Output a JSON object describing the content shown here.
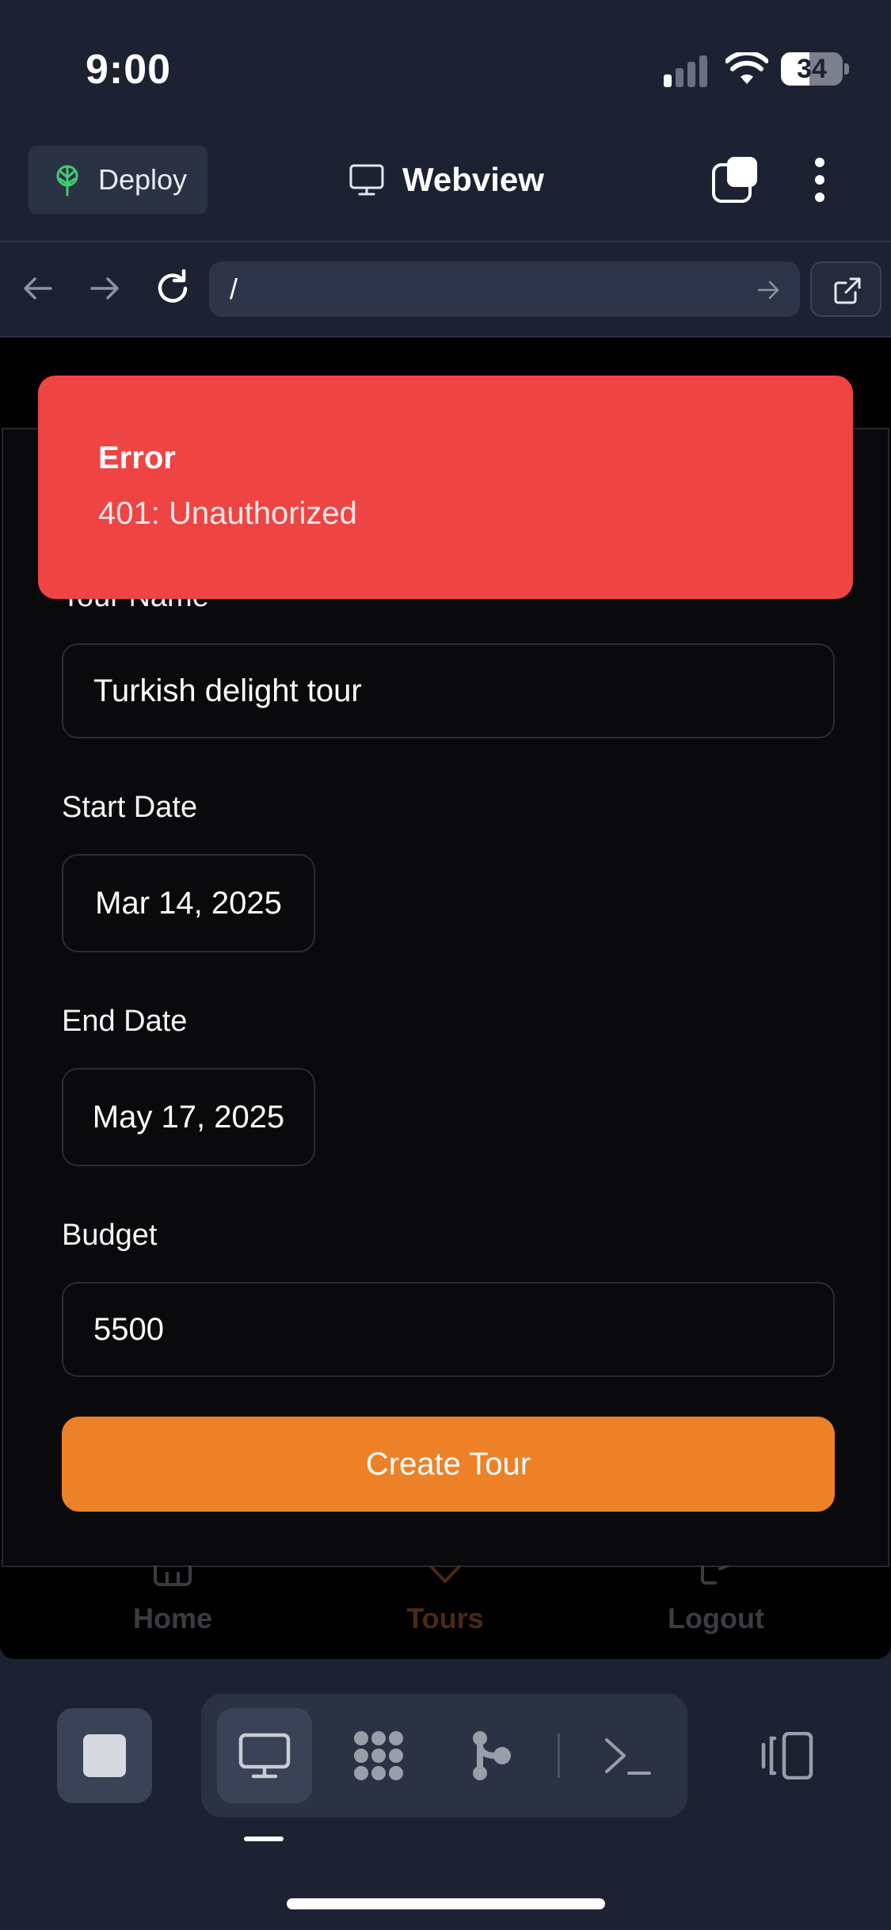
{
  "status_bar": {
    "time": "9:00",
    "battery": "34"
  },
  "header": {
    "deploy_label": "Deploy",
    "title": "Webview"
  },
  "url_bar": {
    "url": "/"
  },
  "toast": {
    "title": "Error",
    "message": "401: Unauthorized"
  },
  "form": {
    "tour_name_label": "Tour Name",
    "tour_name_value": "Turkish delight tour",
    "start_date_label": "Start Date",
    "start_date_value": "Mar 14, 2025",
    "end_date_label": "End Date",
    "end_date_value": "May 17, 2025",
    "budget_label": "Budget",
    "budget_value": "5500",
    "submit_label": "Create Tour"
  },
  "app_nav": {
    "items": [
      {
        "label": "Home",
        "icon": "home-icon"
      },
      {
        "label": "Tours",
        "icon": "heart-icon"
      },
      {
        "label": "Logout",
        "icon": "logout-icon"
      }
    ],
    "active": "Tours"
  },
  "toolbar": {
    "active_tool": "webview",
    "tools": [
      "webview-icon",
      "apps-grid-icon",
      "git-branch-icon",
      "terminal-icon"
    ]
  },
  "colors": {
    "background": "#1d2232",
    "error": "#ef4444",
    "accent": "#ed8127",
    "deploy_icon": "#3ecf6e"
  }
}
